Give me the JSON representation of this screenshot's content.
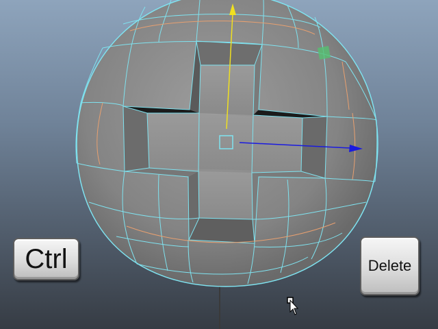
{
  "keys": {
    "ctrl_label": "Ctrl",
    "delete_label": "Delete"
  },
  "colors": {
    "wire": "#7fe3f0",
    "edge_selected": "#e8a070",
    "mesh": "#8c8c8c",
    "y_axis": "#f0e020",
    "x_axis": "#1a1ae0",
    "face_highlight": "#55c070"
  },
  "icons": [
    "move-manipulator-icon",
    "mouse-cursor-icon"
  ]
}
